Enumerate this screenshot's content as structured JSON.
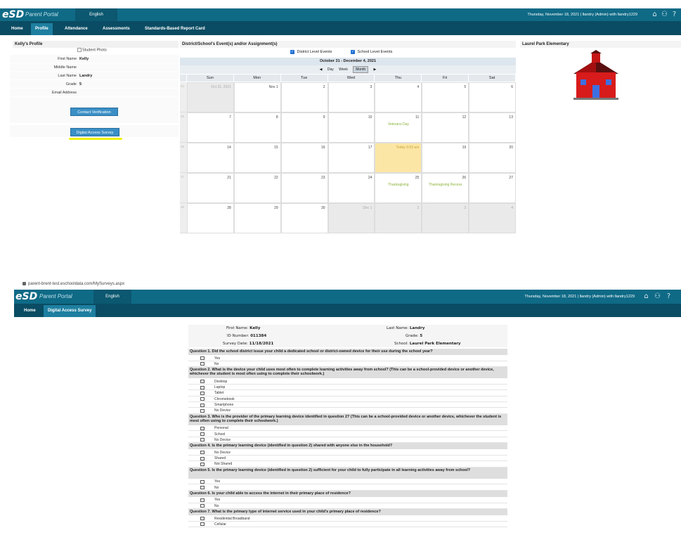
{
  "header": {
    "logo": "eSD",
    "logo_sub": "Parent Portal",
    "language": "English",
    "user_info": "Thursday, November 18, 2021  |  llandry (Admin) with llandry1229"
  },
  "nav": {
    "tabs": [
      "Home",
      "Profile",
      "Attendance",
      "Assessments",
      "Standards-Based Report Card"
    ]
  },
  "profile": {
    "title": "Kelly's Profile",
    "photo_alt": "Student Photo",
    "fields": [
      {
        "label": "First Name",
        "value": "Kelly"
      },
      {
        "label": "Middle Name",
        "value": ""
      },
      {
        "label": "Last Name",
        "value": "Landry"
      },
      {
        "label": "Grade",
        "value": "5"
      },
      {
        "label": "Email Address",
        "value": ""
      }
    ],
    "contact_button": "Contact Verification",
    "survey_button": "Digital Access Survey"
  },
  "events": {
    "title": "District/School's Event(s) and/or Assignment(s)",
    "district_check": "District Level Events",
    "school_check": "School Level Events",
    "range": "October 31 - December 4, 2021",
    "views": [
      "Day",
      "Week",
      "Month"
    ],
    "days_of_week": [
      "Sun",
      "Mon",
      "Tue",
      "Wed",
      "Thu",
      "Fri",
      "Sat"
    ],
    "weeks": [
      {
        "wk": "44",
        "days": [
          {
            "n": "Oct 31, 2021",
            "out": true
          },
          {
            "n": "Nov 1"
          },
          {
            "n": "2"
          },
          {
            "n": "3"
          },
          {
            "n": "4"
          },
          {
            "n": "5"
          },
          {
            "n": "6"
          }
        ]
      },
      {
        "wk": "45",
        "days": [
          {
            "n": "7"
          },
          {
            "n": "8"
          },
          {
            "n": "9"
          },
          {
            "n": "10"
          },
          {
            "n": "11",
            "evt": "Veterans Day"
          },
          {
            "n": "12"
          },
          {
            "n": "13"
          }
        ]
      },
      {
        "wk": "46",
        "days": [
          {
            "n": "14"
          },
          {
            "n": "15"
          },
          {
            "n": "16"
          },
          {
            "n": "17"
          },
          {
            "n": "Today 9:53 am",
            "today": true
          },
          {
            "n": "19"
          },
          {
            "n": "20"
          }
        ]
      },
      {
        "wk": "47",
        "days": [
          {
            "n": "21"
          },
          {
            "n": "22"
          },
          {
            "n": "23"
          },
          {
            "n": "24"
          },
          {
            "n": "25",
            "evt": "Thanksgiving"
          },
          {
            "n": "26",
            "evt": "Thanksgiving Recess"
          },
          {
            "n": "27"
          }
        ]
      },
      {
        "wk": "48",
        "days": [
          {
            "n": "28"
          },
          {
            "n": "29"
          },
          {
            "n": "30"
          },
          {
            "n": "Dec 1",
            "out": true
          },
          {
            "n": "2",
            "out": true
          },
          {
            "n": "3",
            "out": true
          },
          {
            "n": "4",
            "out": true
          }
        ]
      }
    ]
  },
  "school": {
    "title": "Laurel Park Elementary"
  },
  "survey_page": {
    "url": "parent-brent-test.eschooldata.com/MySurveys.aspx",
    "user_info": "Thursday, November 18, 2021  |  llandry (Admin) with llandry1229",
    "tabs": [
      "Home",
      "Digital Access Survey"
    ],
    "info": {
      "first_name_label": "First Name:",
      "first_name": "Kelly",
      "last_name_label": "Last Name:",
      "last_name": "Landry",
      "id_label": "ID Number:",
      "id": "011384",
      "grade_label": "Grade:",
      "grade": "5",
      "date_label": "Survey Date:",
      "date": "11/18/2021",
      "school_label": "School:",
      "school": "Laurel Park Elementary"
    },
    "questions": [
      {
        "q": "Question 1. Did the school district issue your child a dedicated school or district-owned device for their use during the school year?",
        "opts": [
          "Yes",
          "No"
        ]
      },
      {
        "q": "Question 2. What is the device your child uses most often to complete learning activities away from school? (This can be a school-provided device or another device, whichever the student is most often using to complete their schoolwork.)",
        "opts": [
          "Desktop",
          "Laptop",
          "Tablet",
          "Chromebook",
          "Smartphone",
          "No Device"
        ]
      },
      {
        "q": "Question 3. Who is the provider of the primary learning device identified in question 2? (This can be a school-provided device or another device, whichever the student is most often using to complete their schoolwork.)",
        "opts": [
          "Personal",
          "School",
          "No Device"
        ]
      },
      {
        "q": "Question 4. Is the primary learning device (identified in question 2) shared with anyone else in the household?",
        "opts": [
          "No Device",
          "Shared",
          "Not Shared"
        ]
      },
      {
        "q": "Question 5. Is the primary learning device (identified in question 2) sufficient for your child to fully participate in all learning activities away from school?",
        "opts": [
          "Yes",
          "No"
        ]
      },
      {
        "q": "Question 6. Is your child able to access the internet in their primary place of residence?",
        "opts": [
          "Yes",
          "No"
        ]
      },
      {
        "q": "Question 7. What is the primary type of internet service used in your child's primary place of residence?",
        "opts": [
          "Residential Broadband",
          "Cellular"
        ]
      }
    ]
  }
}
